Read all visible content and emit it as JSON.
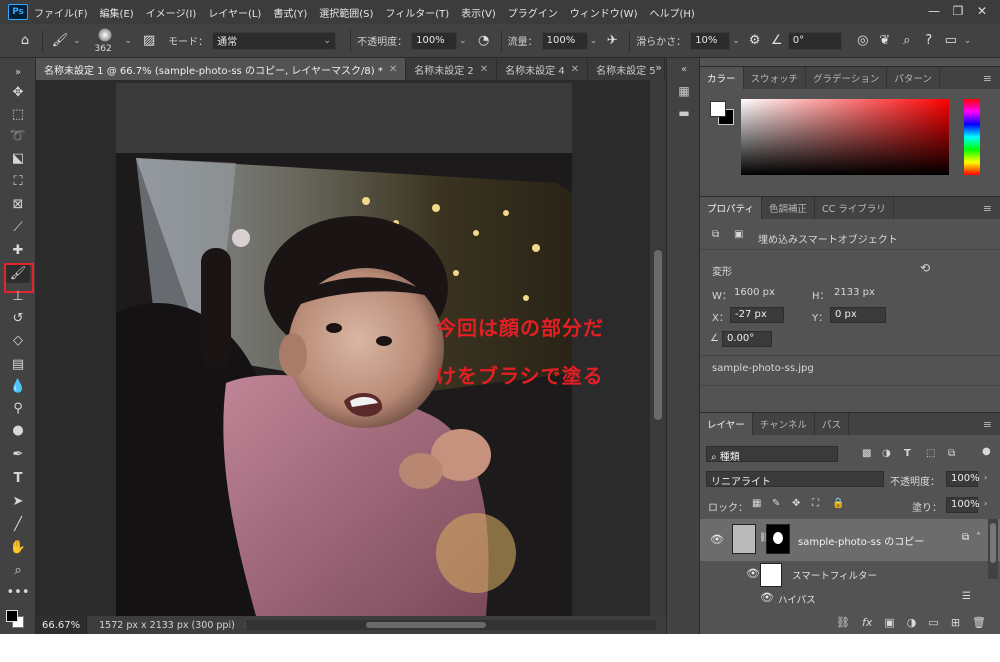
{
  "app": {
    "logo": "Ps"
  },
  "menu": [
    "ファイル(F)",
    "編集(E)",
    "イメージ(I)",
    "レイヤー(L)",
    "書式(Y)",
    "選択範囲(S)",
    "フィルター(T)",
    "表示(V)",
    "プラグイン",
    "ウィンドウ(W)",
    "ヘルプ(H)"
  ],
  "window_controls": {
    "minimize": "—",
    "maximize": "❐",
    "close": "✕"
  },
  "options": {
    "brush_size": "362",
    "mode_label": "モード：",
    "mode_value": "通常",
    "opacity_label": "不透明度：",
    "opacity_value": "100%",
    "flow_label": "流量：",
    "flow_value": "100%",
    "smoothing_label": "滑らかさ：",
    "smoothing_value": "10%",
    "angle_value": "0°"
  },
  "doc_tabs": [
    {
      "label": "名称未設定 1 @ 66.7% (sample-photo-ss のコピー, レイヤーマスク/8) *",
      "active": true
    },
    {
      "label": "名称未設定 2",
      "active": false
    },
    {
      "label": "名称未設定 4",
      "active": false
    },
    {
      "label": "名称未設定 5",
      "active": false
    }
  ],
  "status": {
    "zoom": "66.67%",
    "doc_info": "1572 px x 2133 px (300 ppi)"
  },
  "annotation": {
    "line1": "今回は顔の部分だ",
    "line2": "けをブラシで塗る"
  },
  "color_panel": {
    "tabs": [
      "カラー",
      "スウォッチ",
      "グラデーション",
      "パターン"
    ],
    "fg": "#ffffff",
    "bg": "#000000"
  },
  "properties_panel": {
    "tabs": [
      "プロパティ",
      "色調補正",
      "CC ライブラリ"
    ],
    "object_type": "埋め込みスマートオブジェクト",
    "transform_label": "変形",
    "w_label": "W：",
    "w_value": "1600 px",
    "h_label": "H：",
    "h_value": "2133 px",
    "x_label": "X：",
    "x_value": "-27 px",
    "y_label": "Y：",
    "y_value": "0 px",
    "angle_value": "0.00°",
    "filename": "sample-photo-ss.jpg"
  },
  "layers_panel": {
    "tabs": [
      "レイヤー",
      "チャンネル",
      "パス"
    ],
    "filter_kind": "種類",
    "blend_mode": "リニアライト",
    "opacity_label": "不透明度：",
    "opacity_value": "100%",
    "lock_label": "ロック：",
    "fill_label": "塗り：",
    "fill_value": "100%",
    "layer_name": "sample-photo-ss のコピー",
    "smart_filter_label": "スマートフィルター",
    "highpass_label": "ハイパス",
    "bottom_fx": "fx"
  },
  "colors": {
    "accent_red": "#e0262a",
    "panel_bg": "#535353",
    "dark": "#2b2b2b"
  }
}
